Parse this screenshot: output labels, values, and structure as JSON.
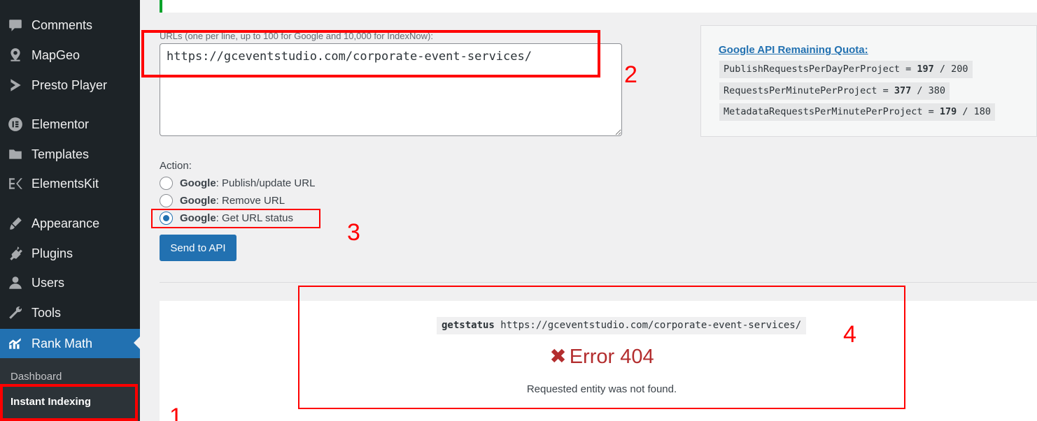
{
  "sidebar": {
    "items": [
      {
        "label": "Comments",
        "icon": "comment-icon"
      },
      {
        "label": "MapGeo",
        "icon": "map-pin-icon"
      },
      {
        "label": "Presto Player",
        "icon": "presto-play-icon"
      },
      {
        "label": "Elementor",
        "icon": "elementor-icon"
      },
      {
        "label": "Templates",
        "icon": "folder-icon"
      },
      {
        "label": "ElementsKit",
        "icon": "elementskit-icon"
      },
      {
        "label": "Appearance",
        "icon": "brush-icon"
      },
      {
        "label": "Plugins",
        "icon": "plug-icon"
      },
      {
        "label": "Users",
        "icon": "user-icon"
      },
      {
        "label": "Tools",
        "icon": "wrench-icon"
      },
      {
        "label": "Rank Math",
        "icon": "rank-math-icon"
      }
    ],
    "submenu": [
      "Dashboard",
      "Instant Indexing"
    ]
  },
  "form": {
    "url_label": "URLs (one per line, up to 100 for Google and 10,000 for IndexNow):",
    "url_value": "https://gceventstudio.com/corporate-event-services/",
    "action_label": "Action:",
    "options": [
      {
        "provider": "Google",
        "text": ": Publish/update URL",
        "checked": false
      },
      {
        "provider": "Google",
        "text": ": Remove URL",
        "checked": false
      },
      {
        "provider": "Google",
        "text": ": Get URL status",
        "checked": true
      }
    ],
    "send_label": "Send to API"
  },
  "quota": {
    "title": "Google API Remaining Quota:",
    "rows": [
      {
        "name": "PublishRequestsPerDayPerProject",
        "eq": " = ",
        "remaining": "197",
        "sep": " / ",
        "limit": "200"
      },
      {
        "name": "RequestsPerMinutePerProject",
        "eq": " = ",
        "remaining": "377",
        "sep": " / ",
        "limit": "380"
      },
      {
        "name": "MetadataRequestsPerMinutePerProject",
        "eq": " = ",
        "remaining": "179",
        "sep": " / ",
        "limit": "180"
      }
    ]
  },
  "result": {
    "command": "getstatus",
    "url": " https://gceventstudio.com/corporate-event-services/",
    "error_symbol": "✖",
    "error_title": "Error 404",
    "error_message": "Requested entity was not found."
  },
  "annotations": [
    "1",
    "2",
    "3",
    "4"
  ],
  "colors": {
    "sidebar_bg": "#1d2327",
    "accent": "#2271b1",
    "error": "#b32d2e",
    "annotation": "#ff0000",
    "notice_border": "#00a32a"
  }
}
